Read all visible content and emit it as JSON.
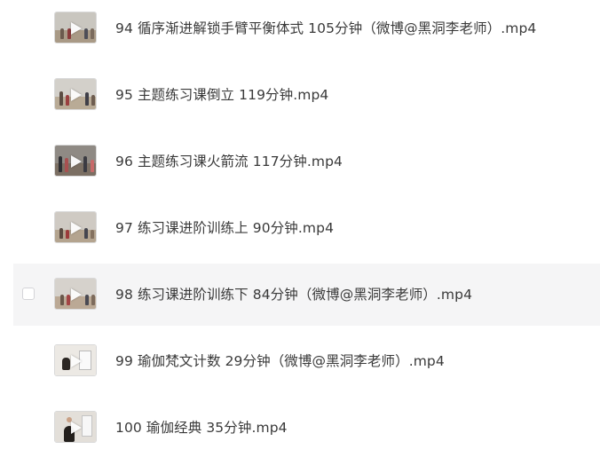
{
  "files": [
    {
      "name": "94 循序渐进解锁手臂平衡体式 105分钟（微博@黑洞李老师）.mp4",
      "thumbnail": "video-thumbnail",
      "icon": "play-icon"
    },
    {
      "name": "95 主题练习课倒立 119分钟.mp4",
      "thumbnail": "video-thumbnail",
      "icon": "play-icon"
    },
    {
      "name": "96 主题练习课火箭流 117分钟.mp4",
      "thumbnail": "video-thumbnail",
      "icon": "play-icon"
    },
    {
      "name": "97 练习课进阶训练上 90分钟.mp4",
      "thumbnail": "video-thumbnail",
      "icon": "play-icon"
    },
    {
      "name": "98 练习课进阶训练下 84分钟（微博@黑洞李老师）.mp4",
      "thumbnail": "video-thumbnail",
      "icon": "play-icon",
      "hovered": true,
      "checked": false
    },
    {
      "name": "99 瑜伽梵文计数 29分钟（微博@黑洞李老师）.mp4",
      "thumbnail": "video-thumbnail",
      "icon": "play-icon"
    },
    {
      "name": "100 瑜伽经典 35分钟.mp4",
      "thumbnail": "video-thumbnail",
      "icon": "play-icon"
    }
  ],
  "colors": {
    "text": "#3a3a3a",
    "hover_background": "#f5f5f6",
    "checkbox_border": "#d4d4d8"
  }
}
